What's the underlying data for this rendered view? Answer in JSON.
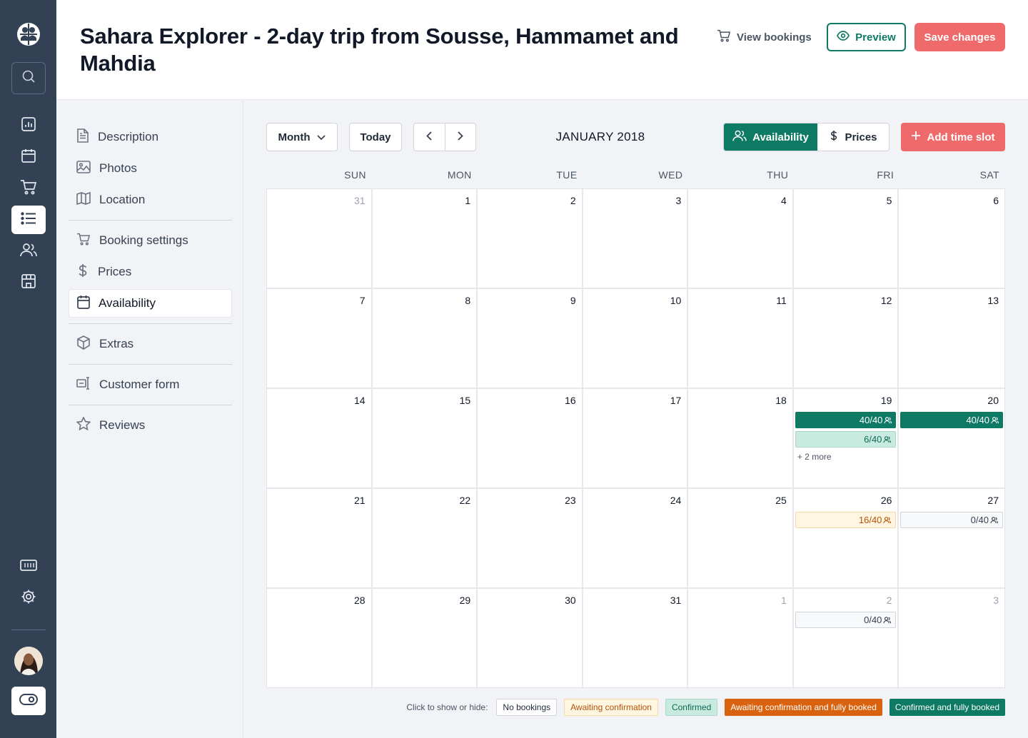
{
  "header": {
    "title": "Sahara Explorer - 2-day trip from Sousse, Hammamet and Mahdia",
    "view_bookings": "View bookings",
    "preview": "Preview",
    "save": "Save changes"
  },
  "rail": {
    "icons": [
      "logo-icon",
      "search-icon",
      "analytics-icon",
      "calendar-icon",
      "cart-icon",
      "list-icon",
      "users-icon",
      "storefront-icon",
      "ticket-icon",
      "settings-icon",
      "avatar",
      "toggle-icon"
    ],
    "active": "list-icon"
  },
  "subnav": {
    "items": [
      {
        "label": "Description",
        "icon": "document-icon"
      },
      {
        "label": "Photos",
        "icon": "photo-icon"
      },
      {
        "label": "Location",
        "icon": "map-icon"
      },
      {
        "label": "Booking settings",
        "icon": "cart-icon"
      },
      {
        "label": "Prices",
        "icon": "dollar-icon"
      },
      {
        "label": "Availability",
        "icon": "calendar-icon",
        "active": true
      },
      {
        "label": "Extras",
        "icon": "box-icon"
      },
      {
        "label": "Customer form",
        "icon": "form-icon"
      },
      {
        "label": "Reviews",
        "icon": "star-icon"
      }
    ]
  },
  "toolbar": {
    "view_mode": "Month",
    "today": "Today",
    "month_label": "JANUARY 2018",
    "availability": "Availability",
    "prices": "Prices",
    "add_slot": "Add time slot"
  },
  "calendar": {
    "weekdays": [
      "SUN",
      "MON",
      "TUE",
      "WED",
      "THU",
      "FRI",
      "SAT"
    ],
    "days": [
      {
        "n": "31",
        "other": true
      },
      {
        "n": "1"
      },
      {
        "n": "2"
      },
      {
        "n": "3"
      },
      {
        "n": "4"
      },
      {
        "n": "5"
      },
      {
        "n": "6"
      },
      {
        "n": "7"
      },
      {
        "n": "8"
      },
      {
        "n": "9"
      },
      {
        "n": "10"
      },
      {
        "n": "11"
      },
      {
        "n": "12"
      },
      {
        "n": "13"
      },
      {
        "n": "14"
      },
      {
        "n": "15"
      },
      {
        "n": "16"
      },
      {
        "n": "17"
      },
      {
        "n": "18"
      },
      {
        "n": "19",
        "slots": [
          {
            "text": "40/40",
            "status": "full-confirmed"
          },
          {
            "text": "6/40",
            "status": "confirmed"
          }
        ],
        "more": "+ 2 more"
      },
      {
        "n": "20",
        "slots": [
          {
            "text": "40/40",
            "status": "full-confirmed"
          }
        ]
      },
      {
        "n": "21"
      },
      {
        "n": "22"
      },
      {
        "n": "23"
      },
      {
        "n": "24"
      },
      {
        "n": "25"
      },
      {
        "n": "26",
        "slots": [
          {
            "text": "16/40",
            "status": "awaiting"
          }
        ]
      },
      {
        "n": "27",
        "slots": [
          {
            "text": "0/40",
            "status": "none"
          }
        ]
      },
      {
        "n": "28"
      },
      {
        "n": "29"
      },
      {
        "n": "30"
      },
      {
        "n": "31"
      },
      {
        "n": "1",
        "other": true
      },
      {
        "n": "2",
        "other": true,
        "slots": [
          {
            "text": "0/40",
            "status": "none"
          }
        ]
      },
      {
        "n": "3",
        "other": true
      }
    ]
  },
  "legend": {
    "label": "Click to show or hide:",
    "items": [
      {
        "label": "No bookings",
        "cls": "c-none"
      },
      {
        "label": "Awaiting confirmation",
        "cls": "c-await"
      },
      {
        "label": "Confirmed",
        "cls": "c-conf"
      },
      {
        "label": "Awaiting confirmation and fully booked",
        "cls": "c-await-full"
      },
      {
        "label": "Confirmed and fully booked",
        "cls": "c-conf-full"
      }
    ]
  },
  "colors": {
    "rail": "#334155",
    "brand_green": "#0f7a64",
    "accent_red": "#ef6b6b",
    "awaiting_full": "#d9620f"
  }
}
